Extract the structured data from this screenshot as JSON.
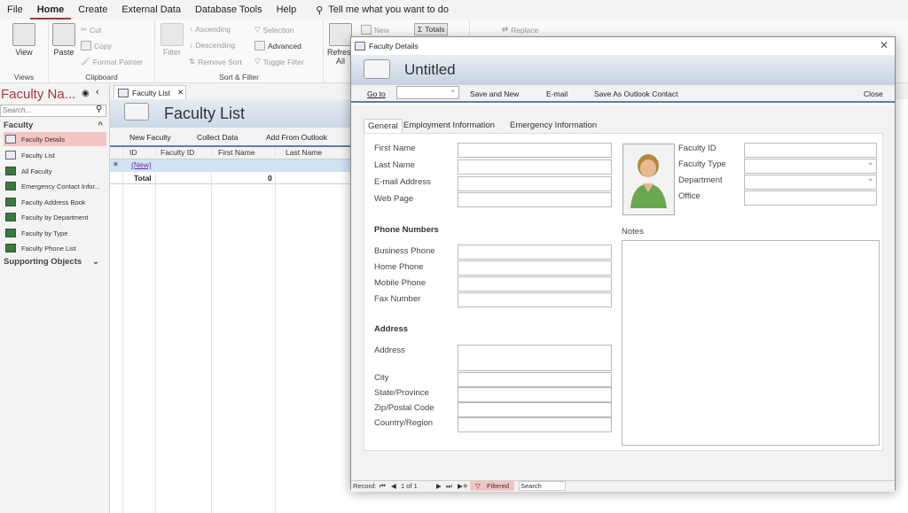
{
  "menubar": {
    "items": [
      "File",
      "Home",
      "Create",
      "External Data",
      "Database Tools",
      "Help"
    ],
    "tell_me": "Tell me what you want to do"
  },
  "ribbon": {
    "views": {
      "view": "View",
      "label": "Views"
    },
    "clipboard": {
      "paste": "Paste",
      "cut": "Cut",
      "copy": "Copy",
      "format_painter": "Format Painter",
      "label": "Clipboard"
    },
    "sort_filter": {
      "filter": "Filter",
      "ascending": "Ascending",
      "descending": "Descending",
      "remove_sort": "Remove Sort",
      "selection": "Selection",
      "advanced": "Advanced",
      "toggle_filter": "Toggle Filter",
      "label": "Sort & Filter"
    },
    "records": {
      "refresh": "Refresh",
      "refresh_all": "All",
      "new": "New",
      "totals": "Totals"
    },
    "find": {
      "replace": "Replace"
    }
  },
  "nav": {
    "title": "Faculty Na...",
    "search_placeholder": "Search...",
    "section": "Faculty",
    "items": [
      {
        "label": "Faculty Details",
        "type": "form"
      },
      {
        "label": "Faculty List",
        "type": "form"
      },
      {
        "label": "All Faculty",
        "type": "table"
      },
      {
        "label": "Emergency Contact Infor...",
        "type": "table"
      },
      {
        "label": "Faculty Address Book",
        "type": "table"
      },
      {
        "label": "Faculty by Department",
        "type": "table"
      },
      {
        "label": "Faculty by Type",
        "type": "table"
      },
      {
        "label": "Faculty Phone List",
        "type": "table"
      }
    ],
    "supporting": "Supporting Objects"
  },
  "faculty_list": {
    "tab": "Faculty List",
    "title": "Faculty List",
    "tools": [
      "New Faculty",
      "Collect Data",
      "Add From Outlook"
    ],
    "columns": [
      "ID",
      "Faculty ID",
      "First Name",
      "Last Name"
    ],
    "new_row": "(New)",
    "total_label": "Total",
    "total_value": "0",
    "new_marker": "✳"
  },
  "dialog": {
    "window_title": "Faculty Details",
    "title": "Untitled",
    "goto": "Go to",
    "save_new": "Save and New",
    "email": "E-mail",
    "save_outlook": "Save As Outlook Contact",
    "close": "Close",
    "tabs": [
      "General",
      "Employment Information",
      "Emergency Information"
    ],
    "fields": {
      "first_name": "First Name",
      "last_name": "Last Name",
      "email": "E-mail Address",
      "web_page": "Web Page",
      "phone_heading": "Phone Numbers",
      "business_phone": "Business Phone",
      "home_phone": "Home Phone",
      "mobile_phone": "Mobile Phone",
      "fax": "Fax Number",
      "address_heading": "Address",
      "address": "Address",
      "city": "City",
      "state": "State/Province",
      "zip": "Zip/Postal Code",
      "country": "Country/Region",
      "faculty_id": "Faculty ID",
      "faculty_type": "Faculty Type",
      "department": "Department",
      "office": "Office",
      "notes": "Notes"
    },
    "status": {
      "record": "Record:",
      "position": "1 of 1",
      "filtered": "Filtered",
      "search": "Search"
    }
  }
}
